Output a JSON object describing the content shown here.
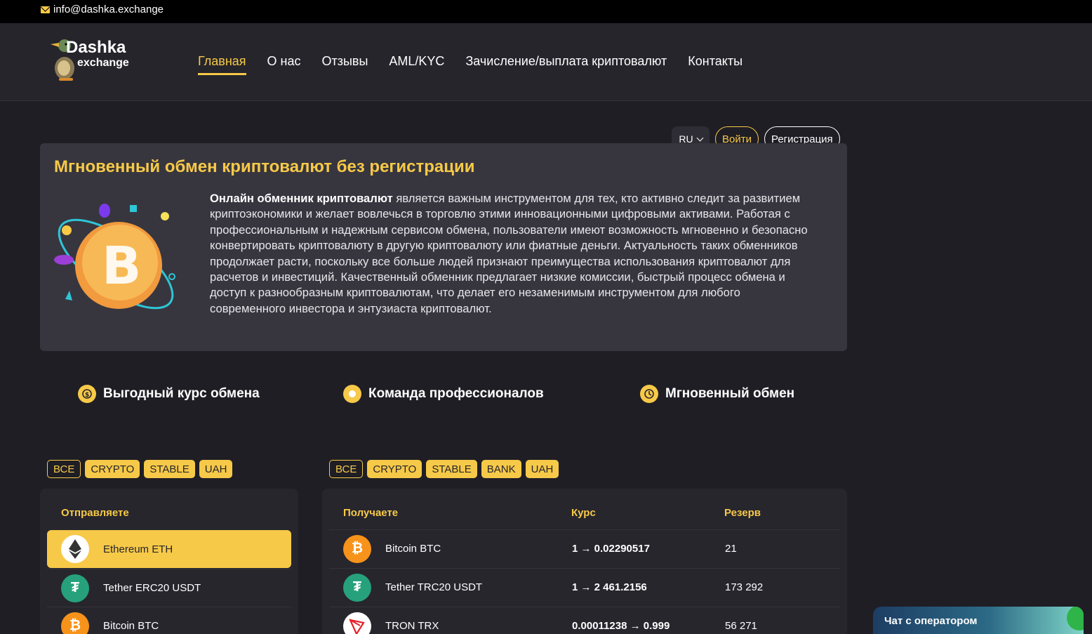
{
  "topbar": {
    "email": "info@dashka.exchange"
  },
  "logo": {
    "line1": "Dashka",
    "line2": "exchange"
  },
  "nav": [
    "Главная",
    "О нас",
    "Отзывы",
    "AML/KYC",
    "Зачисление/выплата криптовалют",
    "Контакты"
  ],
  "auth": {
    "lang": "RU",
    "login": "Войти",
    "register": "Регистрация"
  },
  "hero": {
    "title": "Мгновенный обмен криптовалют без регистрации",
    "bold_lead": "Онлайн обменник криптовалют",
    "text": " является важным инструментом для тех, кто активно следит за развитием криптоэкономики и желает вовлечься в торговлю этими инновационными цифровыми активами. Работая с профессиональным и надежным сервисом обмена, пользователи имеют возможность мгновенно и безопасно конвертировать криптовалюту в другую криптовалюту или фиатные деньги. Актуальность таких обменников продолжает расти, поскольку все больше людей признают преимущества использования криптовалют для расчетов и инвестиций. Качественный обменник предлагает низкие комиссии, быстрый процесс обмена и доступ к разнообразным криптовалютам, что делает его незаменимым инструментом для любого современного инвестора и энтузиаста криптовалют."
  },
  "features": [
    "Выгодный курс обмена",
    "Команда профессионалов",
    "Мгновенный обмен"
  ],
  "filters_send": [
    "ВСЕ",
    "CRYPTO",
    "STABLE",
    "UAH"
  ],
  "filters_receive": [
    "ВСЕ",
    "CRYPTO",
    "STABLE",
    "BANK",
    "UAH"
  ],
  "send": {
    "header": "Отправляете",
    "items": [
      {
        "name": "Ethereum ETH",
        "icon": "ethereum-icon"
      },
      {
        "name": "Tether ERC20 USDT",
        "icon": "tether-icon"
      },
      {
        "name": "Bitcoin BTC",
        "icon": "bitcoin-icon"
      }
    ]
  },
  "receive": {
    "headers": {
      "name": "Получаете",
      "rate": "Курс",
      "reserve": "Резерв"
    },
    "rows": [
      {
        "name": "Bitcoin BTC",
        "rate": "1 → 0.02290517",
        "reserve": "21",
        "icon": "bitcoin-icon"
      },
      {
        "name": "Tether TRC20 USDT",
        "rate": "1 → 2 461.2156",
        "reserve": "173 292",
        "icon": "tether-icon"
      },
      {
        "name": "TRON TRX",
        "rate": "0.00011238 → 0.999",
        "reserve": "56 271",
        "icon": "tron-icon"
      }
    ]
  },
  "chat": {
    "label": "Чат с оператором"
  },
  "colors": {
    "accent": "#f7c948",
    "background": "#1f1e25",
    "card": "#37363f"
  }
}
